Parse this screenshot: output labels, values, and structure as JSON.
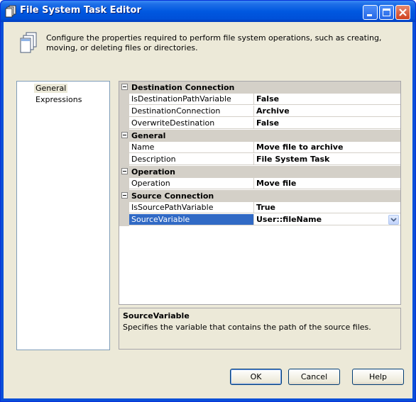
{
  "window": {
    "title": "File System Task Editor"
  },
  "header": {
    "description": "Configure the properties required to perform file system operations, such as creating, moving, or deleting files or directories."
  },
  "nav": {
    "items": [
      {
        "label": "General",
        "selected": true
      },
      {
        "label": "Expressions",
        "selected": false
      }
    ]
  },
  "grid": {
    "categories": [
      {
        "label": "Destination Connection",
        "props": [
          {
            "name": "IsDestinationPathVariable",
            "value": "False"
          },
          {
            "name": "DestinationConnection",
            "value": "Archive"
          },
          {
            "name": "OverwriteDestination",
            "value": "False"
          }
        ]
      },
      {
        "label": "General",
        "props": [
          {
            "name": "Name",
            "value": "Move file to archive"
          },
          {
            "name": "Description",
            "value": "File System Task"
          }
        ]
      },
      {
        "label": "Operation",
        "props": [
          {
            "name": "Operation",
            "value": "Move file"
          }
        ]
      },
      {
        "label": "Source Connection",
        "props": [
          {
            "name": "IsSourcePathVariable",
            "value": "True"
          },
          {
            "name": "SourceVariable",
            "value": "User::fileName"
          }
        ]
      }
    ]
  },
  "description_panel": {
    "title": "SourceVariable",
    "text": "Specifies the variable that contains the path of the source files."
  },
  "buttons": {
    "ok": "OK",
    "cancel": "Cancel",
    "help": "Help"
  },
  "colors": {
    "titlebar": "#0054e3",
    "selection": "#316ac5",
    "dialog_bg": "#ece9d8"
  }
}
